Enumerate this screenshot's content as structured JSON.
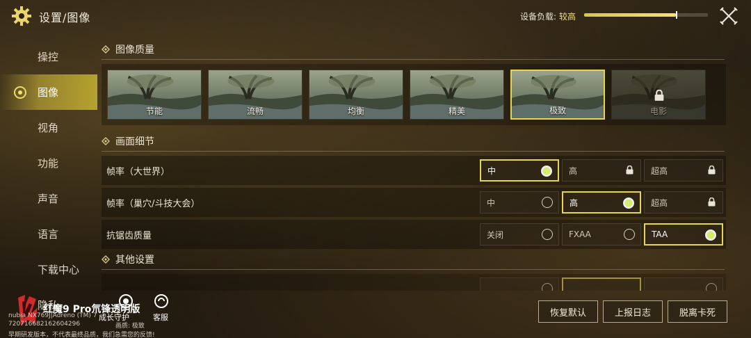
{
  "header": {
    "title": "设置/图像",
    "load_label": "设备负载:",
    "load_value": "较高",
    "load_fraction": 0.74
  },
  "sidebar": {
    "items": [
      {
        "label": "操控",
        "active": false
      },
      {
        "label": "图像",
        "active": true
      },
      {
        "label": "视角",
        "active": false
      },
      {
        "label": "功能",
        "active": false
      },
      {
        "label": "声音",
        "active": false
      },
      {
        "label": "语言",
        "active": false
      },
      {
        "label": "下载中心",
        "active": false
      },
      {
        "label": "隐私",
        "active": false
      }
    ]
  },
  "quality": {
    "heading": "图像质量",
    "options": [
      {
        "label": "节能",
        "state": "normal"
      },
      {
        "label": "流畅",
        "state": "normal"
      },
      {
        "label": "均衡",
        "state": "normal"
      },
      {
        "label": "精美",
        "state": "normal"
      },
      {
        "label": "极致",
        "state": "selected"
      },
      {
        "label": "电影",
        "state": "locked"
      }
    ]
  },
  "detail": {
    "heading": "画面细节",
    "rows": [
      {
        "label": "帧率（大世界）",
        "options": [
          {
            "label": "中",
            "state": "selected"
          },
          {
            "label": "高",
            "state": "locked"
          },
          {
            "label": "超高",
            "state": "locked"
          }
        ]
      },
      {
        "label": "帧率（巢穴/斗技大会）",
        "options": [
          {
            "label": "中",
            "state": "normal"
          },
          {
            "label": "高",
            "state": "selected"
          },
          {
            "label": "超高",
            "state": "locked"
          }
        ]
      },
      {
        "label": "抗锯齿质量",
        "options": [
          {
            "label": "关闭",
            "state": "normal"
          },
          {
            "label": "FXAA",
            "state": "normal"
          },
          {
            "label": "TAA",
            "state": "selected"
          }
        ]
      }
    ]
  },
  "other": {
    "heading": "其他设置"
  },
  "footer": {
    "brand": "红魔9 Pro氘锋透明版",
    "device_line": "nubia NX769J|Adreno (TM) 7",
    "id_line": "720716682162604296",
    "notice": "早期研发版本，不代表最终品质，我们急需您的反馈!",
    "quality_note": "画质: 极致",
    "guardian_label": "成长守护",
    "service_label": "客服",
    "buttons": {
      "reset": "恢复默认",
      "report": "上报日志",
      "unstuck": "脱离卡死"
    }
  },
  "colors": {
    "accent": "#e6d54e",
    "highlight": "#f0e070"
  }
}
